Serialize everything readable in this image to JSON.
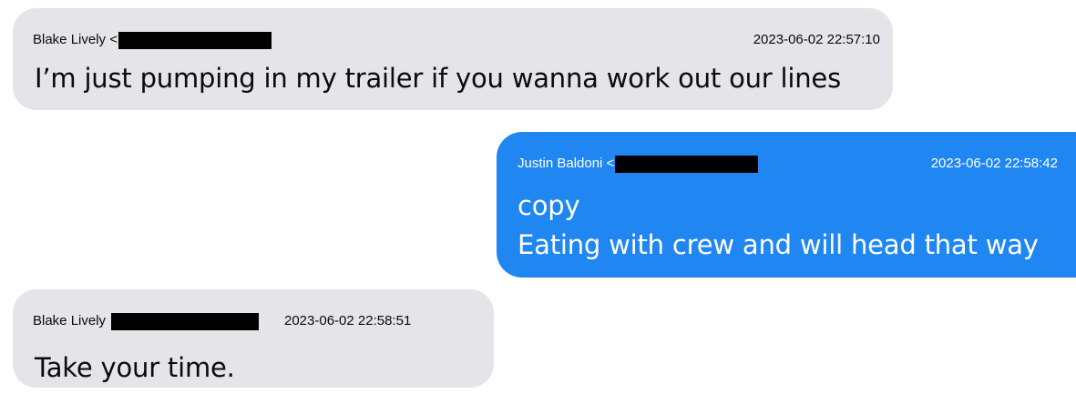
{
  "messages": [
    {
      "direction": "received",
      "sender": "Blake Lively <",
      "timestamp": "2023-06-02 22:57:10",
      "lines": [
        "I’m just pumping in my trailer if you wanna work out our lines"
      ]
    },
    {
      "direction": "sent",
      "sender": "Justin Baldoni <",
      "timestamp": "2023-06-02 22:58:42",
      "lines": [
        "copy",
        "Eating with crew and will head that way"
      ]
    },
    {
      "direction": "received",
      "sender": "Blake Lively",
      "timestamp": "2023-06-02 22:58:51",
      "lines": [
        "Take your time."
      ]
    }
  ],
  "colors": {
    "received_bubble": "#e4e4e9",
    "sent_bubble": "#1f86f2",
    "redaction": "#000000"
  }
}
